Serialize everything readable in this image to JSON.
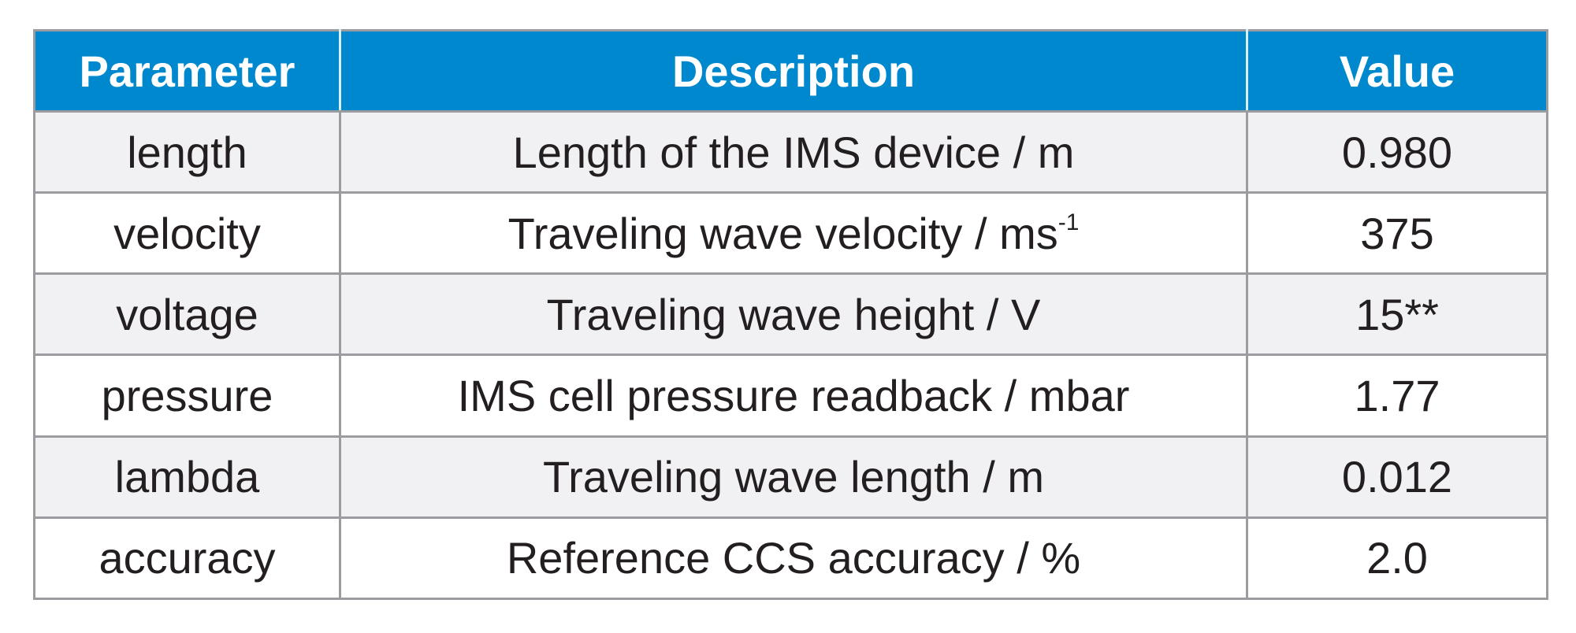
{
  "table": {
    "headers": [
      "Parameter",
      "Description",
      "Value"
    ],
    "header_color": "#0088cf",
    "rows": [
      {
        "parameter": "length",
        "description": "Length of the IMS device / m",
        "description_sup": "",
        "value": "0.980"
      },
      {
        "parameter": "velocity",
        "description": "Traveling wave velocity / ms",
        "description_sup": "-1",
        "value": "375"
      },
      {
        "parameter": "voltage",
        "description": "Traveling wave height / V",
        "description_sup": "",
        "value": "15**"
      },
      {
        "parameter": "pressure",
        "description": "IMS cell pressure readback / mbar",
        "description_sup": "",
        "value": "1.77"
      },
      {
        "parameter": "lambda",
        "description": "Traveling wave length / m",
        "description_sup": "",
        "value": "0.012"
      },
      {
        "parameter": "accuracy",
        "description": "Reference CCS accuracy / %",
        "description_sup": "",
        "value": "2.0"
      }
    ]
  }
}
